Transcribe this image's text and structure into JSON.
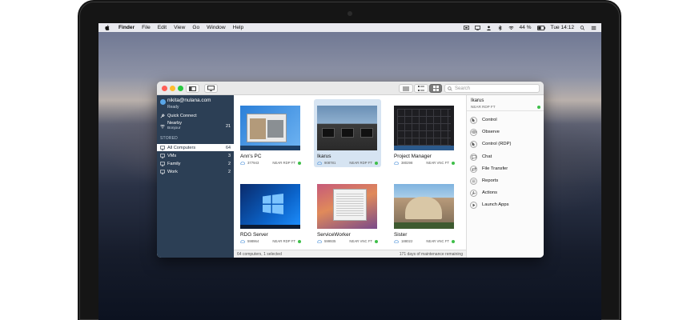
{
  "menubar": {
    "app": "Finder",
    "items": [
      "File",
      "Edit",
      "View",
      "Go",
      "Window",
      "Help"
    ],
    "battery": "44 %",
    "clock": "Tue 14:12"
  },
  "window": {
    "search_placeholder": "Search"
  },
  "sidebar": {
    "account_name": "nikita@nulana.com",
    "account_status": "Ready",
    "quick_connect": "Quick Connect",
    "nearby_label": "Nearby",
    "nearby_sub": "Bonjour",
    "nearby_count": "21",
    "stored_header": "STORED",
    "groups": [
      {
        "label": "All Computers",
        "count": "64"
      },
      {
        "label": "VMs",
        "count": "3"
      },
      {
        "label": "Family",
        "count": "2"
      },
      {
        "label": "Work",
        "count": "2"
      }
    ]
  },
  "computers": [
    {
      "name": "Ann's PC",
      "id": "377943",
      "protocol": "NEAR RDP FT"
    },
    {
      "name": "Ikarus",
      "id": "908781",
      "protocol": "NEAR RDP FT"
    },
    {
      "name": "Project Manager",
      "id": "380298",
      "protocol": "NEAR VNC FT"
    },
    {
      "name": "RDG Server",
      "id": "598964",
      "protocol": "NEAR RDP FT"
    },
    {
      "name": "ServiceWorker",
      "id": "599935",
      "protocol": "NEAR VNC FT"
    },
    {
      "name": "Sister",
      "id": "188022",
      "protocol": "NEAR VNC FT"
    }
  ],
  "status": {
    "left": "64 computers, 1 selected",
    "right": "171 days of maintenance remaining"
  },
  "detail": {
    "name": "Ikarus",
    "protocol": "NEAR RDP FT",
    "actions": [
      "Control",
      "Observe",
      "Control (RDP)",
      "Chat",
      "File Transfer",
      "Reports",
      "Actions",
      "Launch Apps"
    ]
  },
  "colors": {
    "sidebar": "#2c3f55",
    "selected_tile": "#d6e4f2",
    "online": "#3fbf4a"
  }
}
